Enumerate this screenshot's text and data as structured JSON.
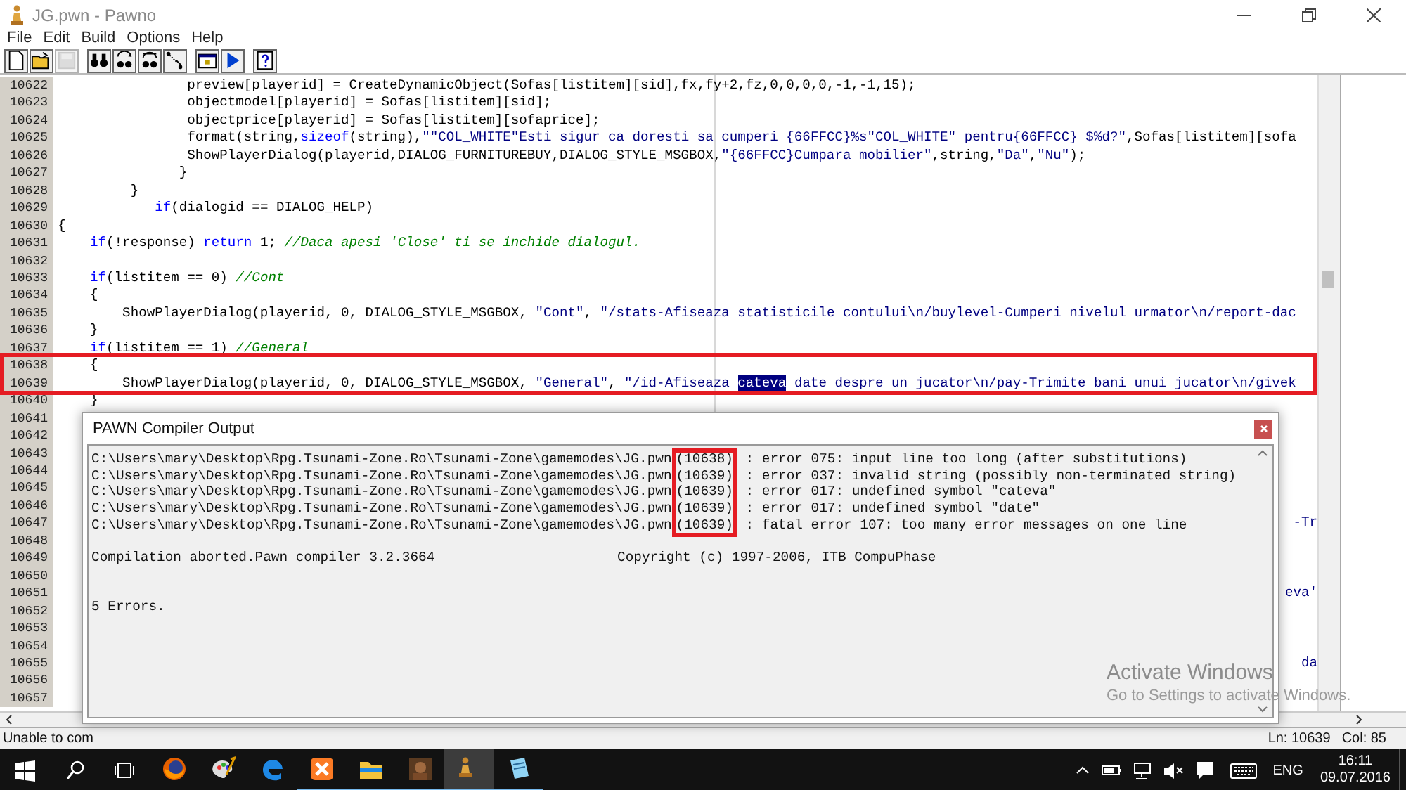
{
  "window": {
    "title": "JG.pwn - Pawno"
  },
  "menu": [
    "File",
    "Edit",
    "Build",
    "Options",
    "Help"
  ],
  "toolbar": [
    {
      "kind": "new",
      "disabled": false
    },
    {
      "kind": "open",
      "disabled": false
    },
    {
      "kind": "save",
      "disabled": true
    },
    {
      "kind": "find",
      "disabled": false
    },
    {
      "kind": "find-next",
      "disabled": false
    },
    {
      "kind": "replace",
      "disabled": false
    },
    {
      "kind": "goto",
      "disabled": false
    },
    {
      "kind": "window",
      "disabled": false
    },
    {
      "kind": "run",
      "disabled": false
    },
    {
      "kind": "help",
      "disabled": false
    }
  ],
  "editor": {
    "lines": [
      {
        "number": "10622",
        "kind": "code",
        "marked": false,
        "segments": [
          {
            "kind": "plain",
            "text": "                preview[playerid] = CreateDynamicObject(Sofas[listitem][sid],fx,fy+2,fz,0,0,0,0,-1,-1,15);"
          }
        ]
      },
      {
        "number": "10623",
        "kind": "code",
        "marked": false,
        "segments": [
          {
            "kind": "plain",
            "text": "                objectmodel[playerid] = Sofas[listitem][sid];"
          }
        ]
      },
      {
        "number": "10624",
        "kind": "code",
        "marked": false,
        "segments": [
          {
            "kind": "plain",
            "text": "                objectprice[playerid] = Sofas[listitem][sofaprice];"
          }
        ]
      },
      {
        "number": "10625",
        "kind": "code",
        "marked": false,
        "segments": [
          {
            "kind": "plain",
            "text": "                format(string,"
          },
          {
            "kind": "keyword",
            "text": "sizeof"
          },
          {
            "kind": "plain",
            "text": "(string),"
          },
          {
            "kind": "string",
            "text": "\"\"COL_WHITE\"Esti sigur ca doresti sa cumperi {66FFCC}%s\"COL_WHITE\" pentru{66FFCC} $%d?\""
          },
          {
            "kind": "plain",
            "text": ",Sofas[listitem][sofa"
          }
        ]
      },
      {
        "number": "10626",
        "kind": "code",
        "marked": false,
        "segments": [
          {
            "kind": "plain",
            "text": "                ShowPlayerDialog(playerid,DIALOG_FURNITUREBUY,DIALOG_STYLE_MSGBOX,"
          },
          {
            "kind": "string",
            "text": "\"{66FFCC}Cumpara mobilier\""
          },
          {
            "kind": "plain",
            "text": ",string,"
          },
          {
            "kind": "string",
            "text": "\"Da\""
          },
          {
            "kind": "plain",
            "text": ","
          },
          {
            "kind": "string",
            "text": "\"Nu\""
          },
          {
            "kind": "plain",
            "text": ");"
          }
        ]
      },
      {
        "number": "10627",
        "kind": "code",
        "marked": false,
        "segments": [
          {
            "kind": "plain",
            "text": "               }"
          }
        ]
      },
      {
        "number": "10628",
        "kind": "code",
        "marked": false,
        "segments": [
          {
            "kind": "plain",
            "text": "         }"
          }
        ]
      },
      {
        "number": "10629",
        "kind": "code",
        "marked": false,
        "segments": [
          {
            "kind": "keyword",
            "text": "            if"
          },
          {
            "kind": "plain",
            "text": "(dialogid == DIALOG_HELP)"
          }
        ]
      },
      {
        "number": "10630",
        "kind": "code",
        "marked": false,
        "segments": [
          {
            "kind": "plain",
            "text": "{"
          }
        ]
      },
      {
        "number": "10631",
        "kind": "code",
        "marked": false,
        "segments": [
          {
            "kind": "keyword",
            "text": "    if"
          },
          {
            "kind": "plain",
            "text": "(!response) "
          },
          {
            "kind": "keyword",
            "text": "return"
          },
          {
            "kind": "plain",
            "text": " 1; "
          },
          {
            "kind": "comment",
            "text": "//Daca apesi 'Close' ti se inchide dialogul."
          }
        ]
      },
      {
        "number": "10632",
        "kind": "code",
        "marked": false
      },
      {
        "number": "10633",
        "kind": "code",
        "marked": false,
        "segments": [
          {
            "kind": "keyword",
            "text": "    if"
          },
          {
            "kind": "plain",
            "text": "(listitem == 0) "
          },
          {
            "kind": "comment",
            "text": "//Cont"
          }
        ]
      },
      {
        "number": "10634",
        "kind": "code",
        "marked": false,
        "segments": [
          {
            "kind": "plain",
            "text": "    {"
          }
        ]
      },
      {
        "number": "10635",
        "kind": "code",
        "marked": false,
        "segments": [
          {
            "kind": "plain",
            "text": "        ShowPlayerDialog(playerid, 0, DIALOG_STYLE_MSGBOX, "
          },
          {
            "kind": "string",
            "text": "\"Cont\""
          },
          {
            "kind": "plain",
            "text": ", "
          },
          {
            "kind": "string",
            "text": "\"/stats-Afiseaza statisticile contului\\n/buylevel-Cumperi nivelul urmator\\n/report-dac"
          }
        ]
      },
      {
        "number": "10636",
        "kind": "code",
        "marked": false,
        "segments": [
          {
            "kind": "plain",
            "text": "    }"
          }
        ]
      },
      {
        "number": "10637",
        "kind": "code",
        "marked": false,
        "segments": [
          {
            "kind": "keyword",
            "text": "    if"
          },
          {
            "kind": "plain",
            "text": "(listitem == 1) "
          },
          {
            "kind": "comment",
            "text": "//General"
          }
        ]
      },
      {
        "number": "10638",
        "kind": "code",
        "marked": true,
        "segments": [
          {
            "kind": "plain",
            "text": "    {"
          }
        ]
      },
      {
        "number": "10639",
        "kind": "code",
        "marked": true,
        "segments": [
          {
            "kind": "plain",
            "text": "        ShowPlayerDialog(playerid, 0, DIALOG_STYLE_MSGBOX, "
          },
          {
            "kind": "string",
            "text": "\"General\""
          },
          {
            "kind": "plain",
            "text": ", "
          },
          {
            "kind": "string",
            "text": "\"/id-Afiseaza "
          },
          {
            "kind": "selected",
            "text": "cateva"
          },
          {
            "kind": "string",
            "text": " date despre un jucator\\n/pay-Trimite bani unui jucator\\n/givek"
          }
        ]
      },
      {
        "number": "10640",
        "kind": "code",
        "marked": false,
        "segments": [
          {
            "kind": "plain",
            "text": "    }"
          }
        ]
      },
      {
        "number": "10641",
        "kind": "code",
        "marked": false
      },
      {
        "number": "10642",
        "kind": "code",
        "marked": false
      },
      {
        "number": "10643",
        "kind": "code",
        "marked": false
      },
      {
        "number": "10644",
        "kind": "code",
        "marked": false
      },
      {
        "number": "10645",
        "kind": "code",
        "marked": false
      },
      {
        "number": "10646",
        "kind": "code",
        "marked": false
      },
      {
        "number": "10647",
        "kind": "tail",
        "marked": false,
        "segments": [
          {
            "kind": "string",
            "text": "-Tr"
          }
        ]
      },
      {
        "number": "10648",
        "kind": "code",
        "marked": false
      },
      {
        "number": "10649",
        "kind": "code",
        "marked": false
      },
      {
        "number": "10650",
        "kind": "code",
        "marked": false
      },
      {
        "number": "10651",
        "kind": "tail",
        "marked": false,
        "segments": [
          {
            "kind": "string",
            "text": "eva'"
          }
        ]
      },
      {
        "number": "10652",
        "kind": "code",
        "marked": false
      },
      {
        "number": "10653",
        "kind": "code",
        "marked": false
      },
      {
        "number": "10654",
        "kind": "code",
        "marked": false
      },
      {
        "number": "10655",
        "kind": "tail",
        "marked": false,
        "segments": [
          {
            "kind": "string",
            "text": "da"
          }
        ]
      },
      {
        "number": "10656",
        "kind": "code",
        "marked": false
      },
      {
        "number": "10657",
        "kind": "code",
        "marked": false
      }
    ]
  },
  "status_bar": {
    "message": "Unable to com",
    "line": "Ln: 10639",
    "column": "Col: 85"
  },
  "compiler_output": {
    "title": "PAWN Compiler Output",
    "errors": [
      {
        "file": "C:\\Users\\mary\\Desktop\\Rpg.Tsunami-Zone.Ro\\Tsunami-Zone\\gamemodes\\JG.pwn",
        "line_ref": "(10638)",
        "message": " : error 075: input line too long (after substitutions)",
        "marked": true
      },
      {
        "file": "C:\\Users\\mary\\Desktop\\Rpg.Tsunami-Zone.Ro\\Tsunami-Zone\\gamemodes\\JG.pwn",
        "line_ref": "(10639)",
        "message": " : error 037: invalid string (possibly non-terminated string)",
        "marked": true
      },
      {
        "file": "C:\\Users\\mary\\Desktop\\Rpg.Tsunami-Zone.Ro\\Tsunami-Zone\\gamemodes\\JG.pwn",
        "line_ref": "(10639)",
        "message": " : error 017: undefined symbol \"cateva\"",
        "marked": true
      },
      {
        "file": "C:\\Users\\mary\\Desktop\\Rpg.Tsunami-Zone.Ro\\Tsunami-Zone\\gamemodes\\JG.pwn",
        "line_ref": "(10639)",
        "message": " : error 017: undefined symbol \"date\"",
        "marked": true
      },
      {
        "file": "C:\\Users\\mary\\Desktop\\Rpg.Tsunami-Zone.Ro\\Tsunami-Zone\\gamemodes\\JG.pwn",
        "line_ref": "(10639)",
        "message": " : fatal error 107: too many error messages on one line",
        "marked": true
      }
    ],
    "summary": "Compilation aborted.Pawn compiler 3.2.3664",
    "copyright": "Copyright (c) 1997-2006, ITB CompuPhase",
    "result": "5 Errors."
  },
  "activation_notice": {
    "title": "Activate Windows",
    "detail": "Go to Settings to activate Windows."
  },
  "taskbar": {
    "apps": [
      {
        "kind": "firefox",
        "running": false,
        "active": false
      },
      {
        "kind": "paint",
        "running": false,
        "active": false
      },
      {
        "kind": "edge",
        "running": false,
        "active": false
      },
      {
        "kind": "xampp",
        "running": true,
        "active": false
      },
      {
        "kind": "folder",
        "running": true,
        "active": false
      },
      {
        "kind": "game",
        "running": true,
        "active": false
      },
      {
        "kind": "pawno",
        "running": true,
        "active": true
      },
      {
        "kind": "notepad",
        "running": true,
        "active": false
      }
    ],
    "language": "ENG",
    "time": "16:11",
    "date": "09.07.2016"
  }
}
